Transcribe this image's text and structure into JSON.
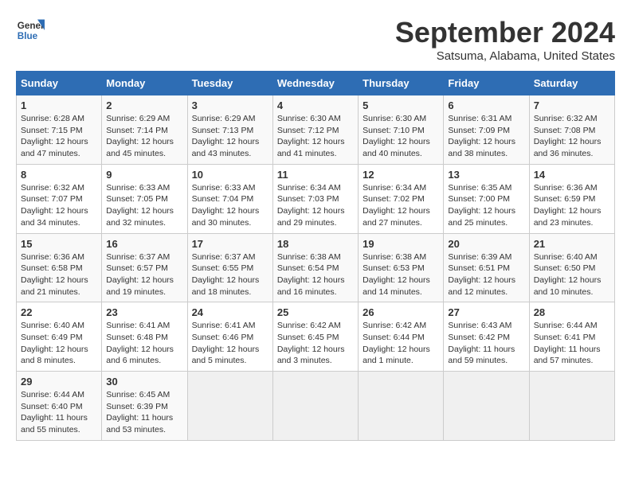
{
  "header": {
    "logo_line1": "General",
    "logo_line2": "Blue",
    "month": "September 2024",
    "location": "Satsuma, Alabama, United States"
  },
  "weekdays": [
    "Sunday",
    "Monday",
    "Tuesday",
    "Wednesday",
    "Thursday",
    "Friday",
    "Saturday"
  ],
  "weeks": [
    [
      {
        "day": "1",
        "sunrise": "6:28 AM",
        "sunset": "7:15 PM",
        "daylight": "12 hours and 47 minutes."
      },
      {
        "day": "2",
        "sunrise": "6:29 AM",
        "sunset": "7:14 PM",
        "daylight": "12 hours and 45 minutes."
      },
      {
        "day": "3",
        "sunrise": "6:29 AM",
        "sunset": "7:13 PM",
        "daylight": "12 hours and 43 minutes."
      },
      {
        "day": "4",
        "sunrise": "6:30 AM",
        "sunset": "7:12 PM",
        "daylight": "12 hours and 41 minutes."
      },
      {
        "day": "5",
        "sunrise": "6:30 AM",
        "sunset": "7:10 PM",
        "daylight": "12 hours and 40 minutes."
      },
      {
        "day": "6",
        "sunrise": "6:31 AM",
        "sunset": "7:09 PM",
        "daylight": "12 hours and 38 minutes."
      },
      {
        "day": "7",
        "sunrise": "6:32 AM",
        "sunset": "7:08 PM",
        "daylight": "12 hours and 36 minutes."
      }
    ],
    [
      {
        "day": "8",
        "sunrise": "6:32 AM",
        "sunset": "7:07 PM",
        "daylight": "12 hours and 34 minutes."
      },
      {
        "day": "9",
        "sunrise": "6:33 AM",
        "sunset": "7:05 PM",
        "daylight": "12 hours and 32 minutes."
      },
      {
        "day": "10",
        "sunrise": "6:33 AM",
        "sunset": "7:04 PM",
        "daylight": "12 hours and 30 minutes."
      },
      {
        "day": "11",
        "sunrise": "6:34 AM",
        "sunset": "7:03 PM",
        "daylight": "12 hours and 29 minutes."
      },
      {
        "day": "12",
        "sunrise": "6:34 AM",
        "sunset": "7:02 PM",
        "daylight": "12 hours and 27 minutes."
      },
      {
        "day": "13",
        "sunrise": "6:35 AM",
        "sunset": "7:00 PM",
        "daylight": "12 hours and 25 minutes."
      },
      {
        "day": "14",
        "sunrise": "6:36 AM",
        "sunset": "6:59 PM",
        "daylight": "12 hours and 23 minutes."
      }
    ],
    [
      {
        "day": "15",
        "sunrise": "6:36 AM",
        "sunset": "6:58 PM",
        "daylight": "12 hours and 21 minutes."
      },
      {
        "day": "16",
        "sunrise": "6:37 AM",
        "sunset": "6:57 PM",
        "daylight": "12 hours and 19 minutes."
      },
      {
        "day": "17",
        "sunrise": "6:37 AM",
        "sunset": "6:55 PM",
        "daylight": "12 hours and 18 minutes."
      },
      {
        "day": "18",
        "sunrise": "6:38 AM",
        "sunset": "6:54 PM",
        "daylight": "12 hours and 16 minutes."
      },
      {
        "day": "19",
        "sunrise": "6:38 AM",
        "sunset": "6:53 PM",
        "daylight": "12 hours and 14 minutes."
      },
      {
        "day": "20",
        "sunrise": "6:39 AM",
        "sunset": "6:51 PM",
        "daylight": "12 hours and 12 minutes."
      },
      {
        "day": "21",
        "sunrise": "6:40 AM",
        "sunset": "6:50 PM",
        "daylight": "12 hours and 10 minutes."
      }
    ],
    [
      {
        "day": "22",
        "sunrise": "6:40 AM",
        "sunset": "6:49 PM",
        "daylight": "12 hours and 8 minutes."
      },
      {
        "day": "23",
        "sunrise": "6:41 AM",
        "sunset": "6:48 PM",
        "daylight": "12 hours and 6 minutes."
      },
      {
        "day": "24",
        "sunrise": "6:41 AM",
        "sunset": "6:46 PM",
        "daylight": "12 hours and 5 minutes."
      },
      {
        "day": "25",
        "sunrise": "6:42 AM",
        "sunset": "6:45 PM",
        "daylight": "12 hours and 3 minutes."
      },
      {
        "day": "26",
        "sunrise": "6:42 AM",
        "sunset": "6:44 PM",
        "daylight": "12 hours and 1 minute."
      },
      {
        "day": "27",
        "sunrise": "6:43 AM",
        "sunset": "6:42 PM",
        "daylight": "11 hours and 59 minutes."
      },
      {
        "day": "28",
        "sunrise": "6:44 AM",
        "sunset": "6:41 PM",
        "daylight": "11 hours and 57 minutes."
      }
    ],
    [
      {
        "day": "29",
        "sunrise": "6:44 AM",
        "sunset": "6:40 PM",
        "daylight": "11 hours and 55 minutes."
      },
      {
        "day": "30",
        "sunrise": "6:45 AM",
        "sunset": "6:39 PM",
        "daylight": "11 hours and 53 minutes."
      },
      null,
      null,
      null,
      null,
      null
    ]
  ]
}
